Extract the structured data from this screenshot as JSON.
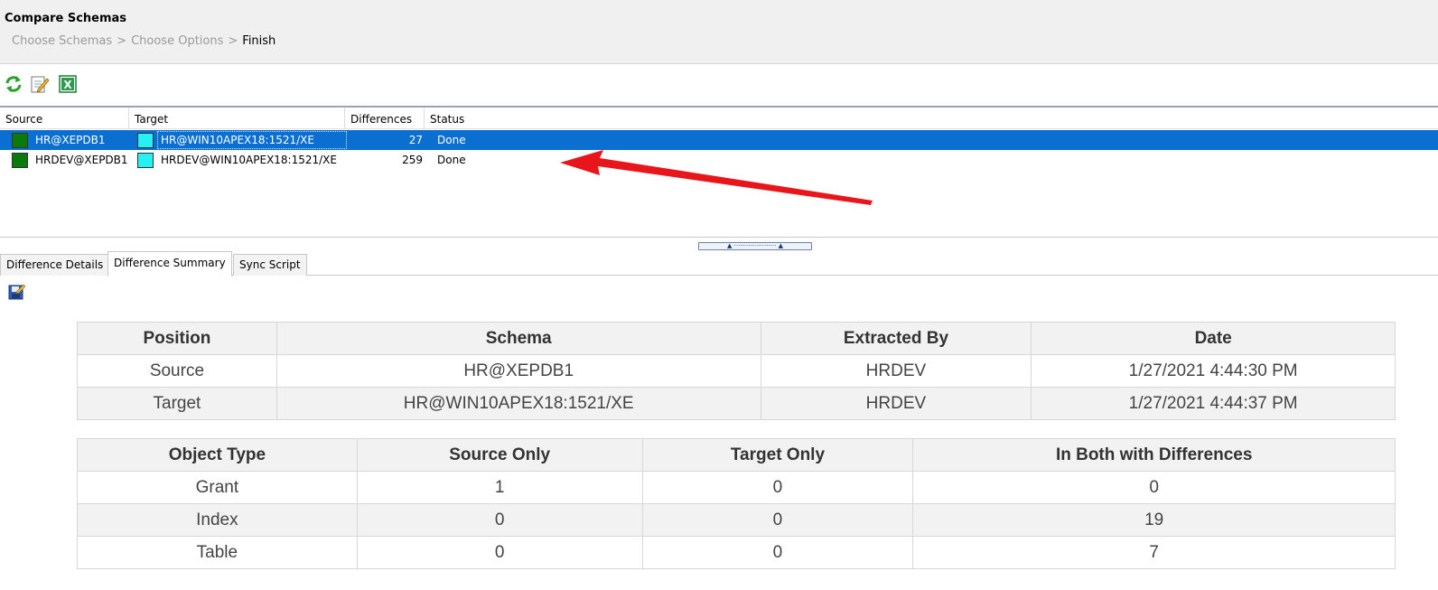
{
  "header": {
    "title": "Compare Schemas",
    "breadcrumb": [
      "Choose Schemas",
      "Choose Options",
      "Finish"
    ],
    "separator": ">"
  },
  "toolbar": {
    "buttons": [
      {
        "icon": "refresh-icon"
      },
      {
        "icon": "edit-icon"
      },
      {
        "icon": "excel-icon"
      }
    ]
  },
  "grid": {
    "columns": [
      "Source",
      "Target",
      "Differences",
      "Status"
    ],
    "rows": [
      {
        "source": "HR@XEPDB1",
        "target": "HR@WIN10APEX18:1521/XE",
        "differences": "27",
        "status": "Done",
        "selected": true
      },
      {
        "source": "HRDEV@XEPDB1",
        "target": "HRDEV@WIN10APEX18:1521/XE",
        "differences": "259",
        "status": "Done",
        "selected": false
      }
    ],
    "source_color": "#0a7a0a",
    "target_color": "#27f0f4",
    "selection_color": "#0b6fd1"
  },
  "annotation": {
    "arrow_color": "#e8151b"
  },
  "tabs": [
    {
      "label": "Difference Details",
      "active": false
    },
    {
      "label": "Difference Summary",
      "active": true
    },
    {
      "label": "Sync Script",
      "active": false
    }
  ],
  "summary": {
    "schemas": {
      "headers": [
        "Position",
        "Schema",
        "Extracted By",
        "Date"
      ],
      "rows": [
        [
          "Source",
          "HR@XEPDB1",
          "HRDEV",
          "1/27/2021 4:44:30 PM"
        ],
        [
          "Target",
          "HR@WIN10APEX18:1521/XE",
          "HRDEV",
          "1/27/2021 4:44:37 PM"
        ]
      ]
    },
    "objects": {
      "headers": [
        "Object Type",
        "Source Only",
        "Target Only",
        "In Both with Differences"
      ],
      "rows": [
        [
          "Grant",
          "1",
          "0",
          "0"
        ],
        [
          "Index",
          "0",
          "0",
          "19"
        ],
        [
          "Table",
          "0",
          "0",
          "7"
        ]
      ]
    }
  }
}
